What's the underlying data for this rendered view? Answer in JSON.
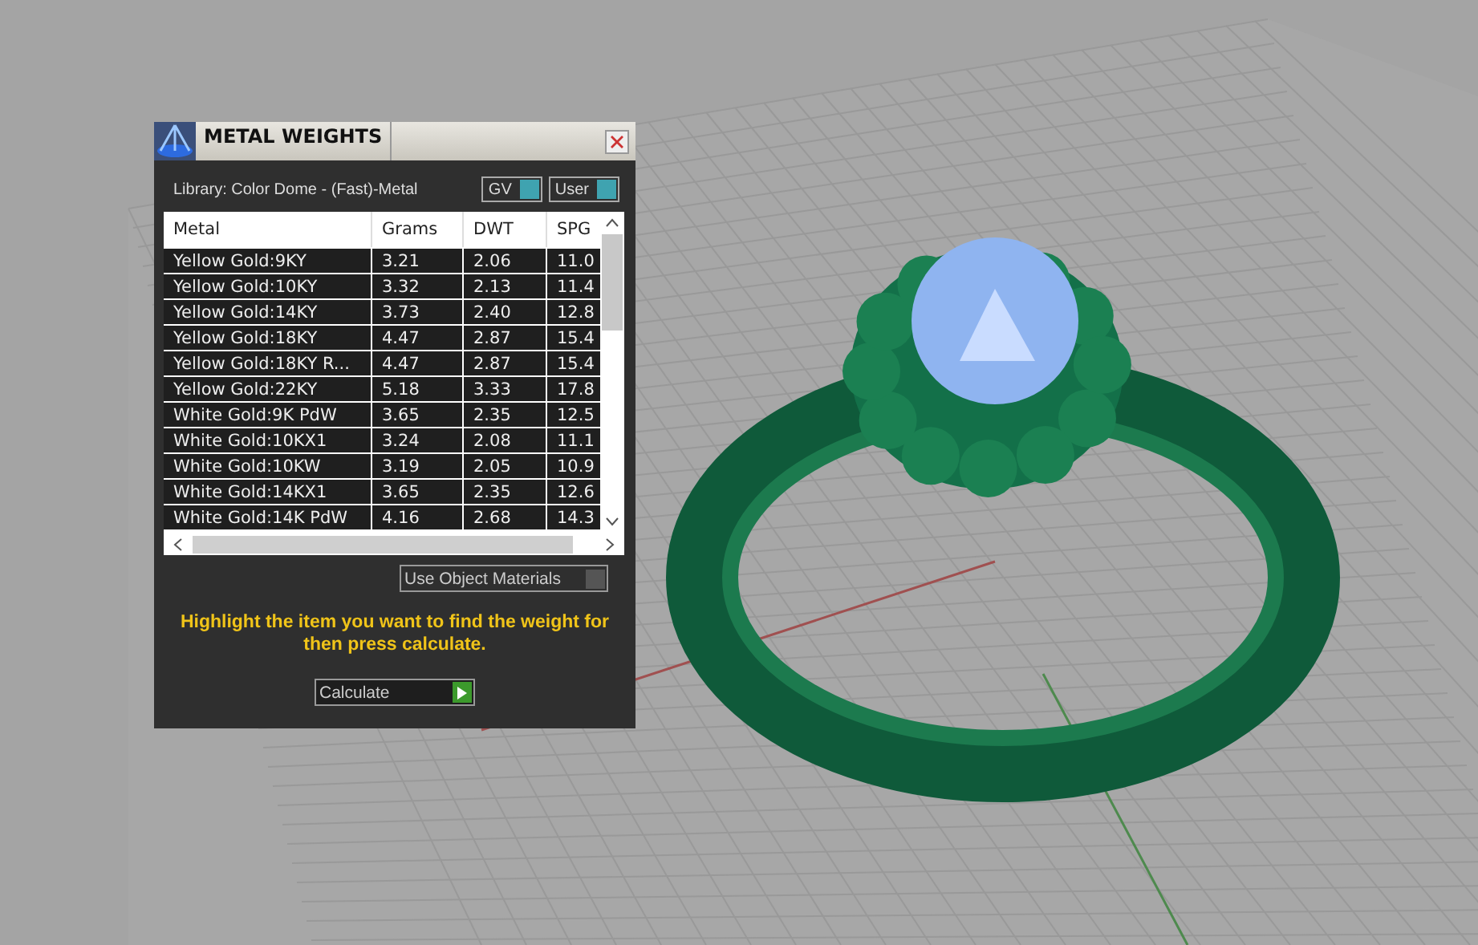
{
  "panel": {
    "title": "METAL WEIGHTS",
    "library": "Library: Color Dome - (Fast)-Metal",
    "toggles": [
      {
        "label": "GV",
        "on": true
      },
      {
        "label": "User",
        "on": true
      }
    ],
    "table": {
      "columns": [
        "Metal",
        "Grams",
        "DWT",
        "SPG"
      ],
      "rows": [
        [
          "Yellow Gold:9KY",
          "3.21",
          "2.06",
          "11.0"
        ],
        [
          "Yellow Gold:10KY",
          "3.32",
          "2.13",
          "11.4"
        ],
        [
          "Yellow Gold:14KY",
          "3.73",
          "2.40",
          "12.8"
        ],
        [
          "Yellow Gold:18KY",
          "4.47",
          "2.87",
          "15.4"
        ],
        [
          "Yellow Gold:18KY R...",
          "4.47",
          "2.87",
          "15.4"
        ],
        [
          "Yellow Gold:22KY",
          "5.18",
          "3.33",
          "17.8"
        ],
        [
          "White Gold:9K PdW",
          "3.65",
          "2.35",
          "12.5"
        ],
        [
          "White Gold:10KX1",
          "3.24",
          "2.08",
          "11.1"
        ],
        [
          "White Gold:10KW",
          "3.19",
          "2.05",
          "10.9"
        ],
        [
          "White Gold:14KX1",
          "3.65",
          "2.35",
          "12.6"
        ],
        [
          "White Gold:14K PdW",
          "4.16",
          "2.68",
          "14.3"
        ]
      ]
    },
    "use_object_materials": {
      "label": "Use Object Materials",
      "on": false
    },
    "hint": "Highlight the item you want to find the weight for then press calculate.",
    "calculate_button": "Calculate"
  }
}
